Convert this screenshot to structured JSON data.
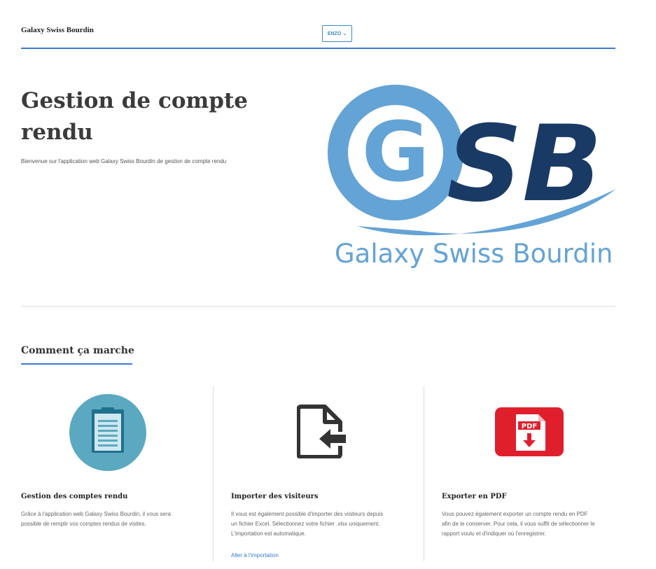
{
  "header": {
    "brand": "Galaxy Swiss Bourdin",
    "user_button": "ENZO",
    "user_icon": "chevron-down-icon"
  },
  "hero": {
    "title": "Gestion de compte rendu",
    "subtitle": "Bienvenue sur l'application web Galaxy Swiss Bourdin de gestion de compte rendu"
  },
  "logo": {
    "letters_g": "G",
    "letters_sb": "SB",
    "wordmark": "Galaxy Swiss Bourdin",
    "colors": {
      "light_blue": "#64a3d6",
      "dark_blue": "#1a3a66"
    }
  },
  "how_it_works": {
    "title": "Comment ça marche",
    "features": [
      {
        "icon": "clipboard-icon",
        "title": "Gestion des comptes rendu",
        "text": "Grâce à l'application web Galaxy Swiss Bourdin, il vous sera\npossible de remplir vos comptes rendus de visites."
      },
      {
        "icon": "file-import-icon",
        "title": "Importer des visiteurs",
        "text": "Il vous est également possible d'importer des visiteurs depuis\nun fichier Excel. Sélectionnez votre fichier .xlsx uniquement.\nL'importation est automatique.",
        "link": "Aller à l'importation"
      },
      {
        "icon": "pdf-download-icon",
        "icon_label": "PDF",
        "title": "Exporter en PDF",
        "text": "Vous pouvez également exporter un compte rendu en PDF\nafin de le conserver. Pour cela, il vous suffit de sélectionner le\nrapport voulu et d'indiquer où l'enregistrer."
      }
    ]
  },
  "colors": {
    "accent": "#3a7bd5",
    "clipboard_circle": "#5aa9c0",
    "pdf_red": "#e01f2d"
  }
}
